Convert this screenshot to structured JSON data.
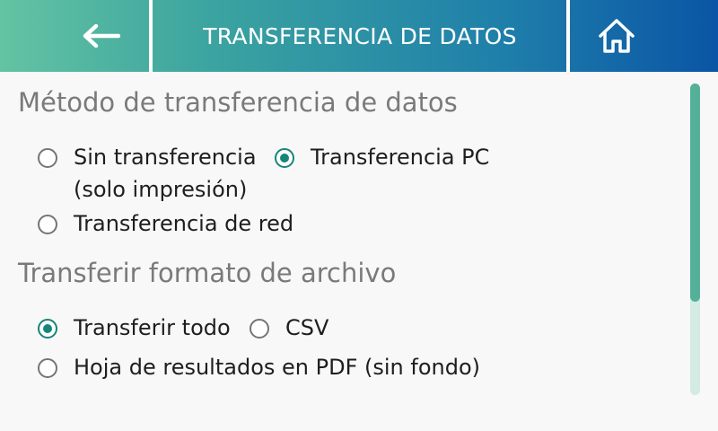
{
  "header": {
    "title": "TRANSFERENCIA DE DATOS",
    "back_icon": "arrow-left-icon",
    "home_icon": "home-icon"
  },
  "sections": [
    {
      "title": "Método de transferencia de datos",
      "options": [
        {
          "line1": "Sin transferencia",
          "line2": "(solo impresión)",
          "checked": false
        },
        {
          "line1": "Transferencia PC",
          "checked": true
        },
        {
          "line1": "Transferencia de red",
          "checked": false
        }
      ]
    },
    {
      "title": "Transferir formato de archivo",
      "options": [
        {
          "line1": "Transferir todo",
          "checked": true
        },
        {
          "line1": "CSV",
          "checked": false
        },
        {
          "line1": "Hoja de resultados en PDF (sin fondo)",
          "checked": false
        }
      ]
    }
  ],
  "colors": {
    "accent": "#16857a",
    "header_start": "#63c3a2",
    "header_end": "#0a55a5",
    "scrollbar_thumb": "#55b09a",
    "scrollbar_track": "#d3ebe2"
  }
}
